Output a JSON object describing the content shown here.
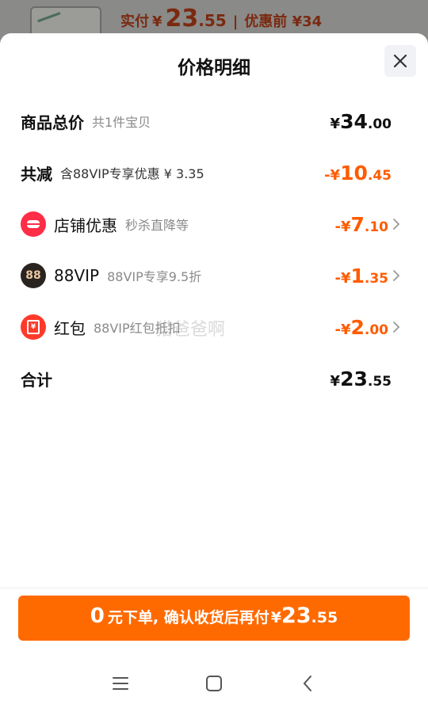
{
  "backdrop": {
    "label": "实付",
    "yen": "¥",
    "price_int": "23",
    "price_dec": ".55",
    "separator": "|",
    "original": "优惠前 ¥34"
  },
  "sheet": {
    "title": "价格明细"
  },
  "rows": {
    "total": {
      "label": "商品总价",
      "sub": "共1件宝贝",
      "yen": "¥",
      "int": "34",
      "dec": ".00"
    },
    "discount": {
      "label": "共减",
      "sub": "含88VIP专享优惠 ¥ 3.35",
      "yen": "-¥",
      "int": "10",
      "dec": ".45"
    },
    "store": {
      "label": "店铺优惠",
      "sub": "秒杀直降等",
      "yen": "-¥",
      "int": "7",
      "dec": ".10"
    },
    "vip": {
      "label": "88VIP",
      "sub": "88VIP专享9.5折",
      "badge": "88",
      "yen": "-¥",
      "int": "1",
      "dec": ".35"
    },
    "redpacket": {
      "label": "红包",
      "sub": "88VIP红包抵扣",
      "badge": "¥",
      "yen": "-¥",
      "int": "2",
      "dec": ".00"
    },
    "sum": {
      "label": "合计",
      "yen": "¥",
      "int": "23",
      "dec": ".55"
    }
  },
  "watermark": "猎爸爸啊",
  "pay_button": {
    "zero": "0",
    "text": "元下单, 确认收货后再付",
    "yen": "¥",
    "int": "23",
    "dec": ".55"
  },
  "colors": {
    "accent": "#ff6a00",
    "discount": "#ff5b00",
    "store_icon": "#ff2d46",
    "red_packet_icon": "#ff3a2b"
  },
  "icons": [
    "close-icon",
    "store-icon",
    "vip-icon",
    "red-packet-icon",
    "chevron-right-icon",
    "menu-icon",
    "home-icon",
    "back-icon"
  ]
}
